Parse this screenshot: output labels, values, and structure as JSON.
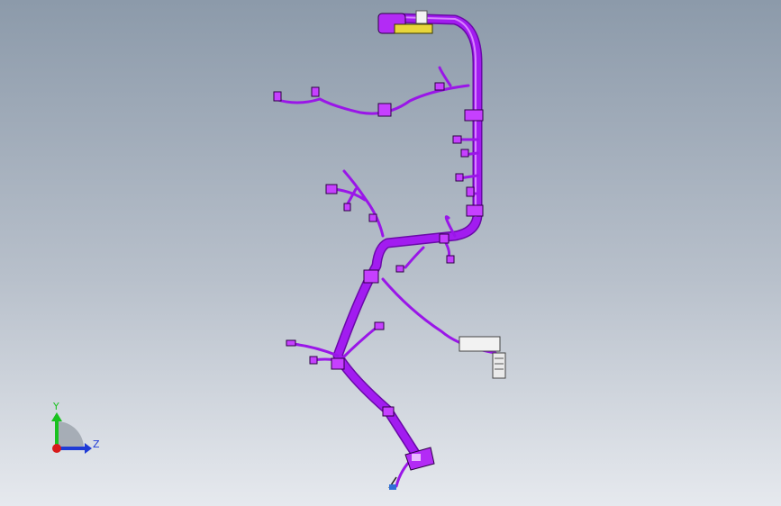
{
  "viewport": {
    "background_top": "#8c9aaa",
    "background_bottom": "#e6e9ee"
  },
  "model": {
    "harness_color": "#a21cf0",
    "harness_highlight": "#d783ff",
    "connector_color": "#c640ff"
  },
  "triad": {
    "y_label": "Y",
    "z_label": "Z",
    "y_color": "#19c21f",
    "z_color": "#1f3bd6",
    "x_color": "#d81a1a"
  }
}
